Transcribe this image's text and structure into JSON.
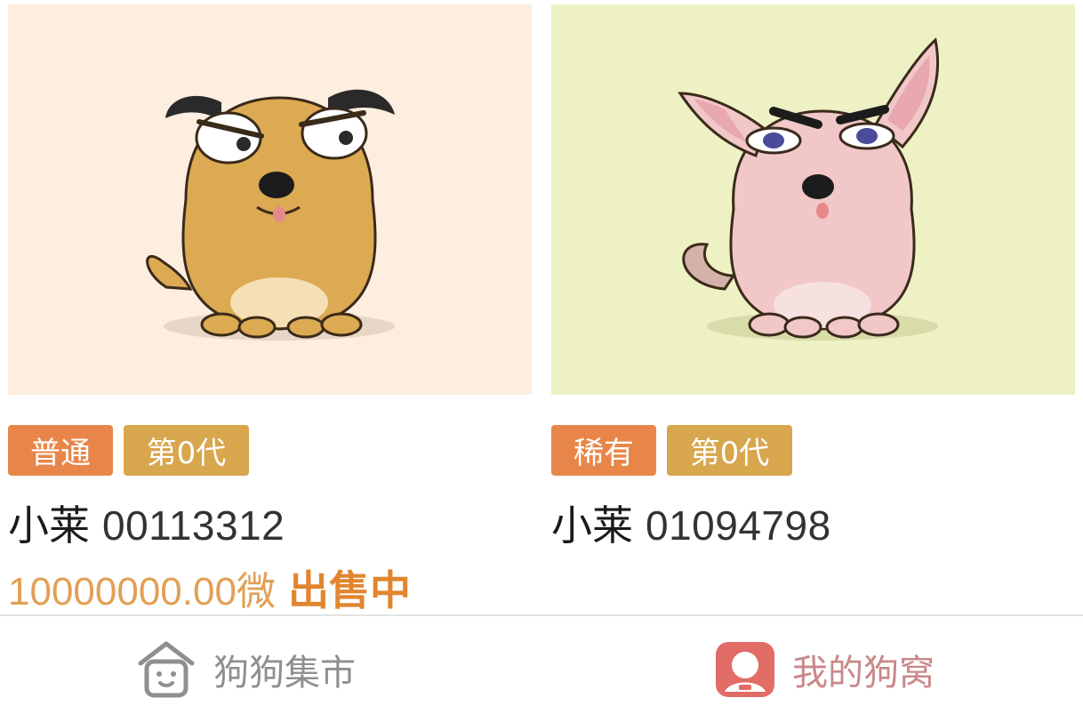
{
  "cards": [
    {
      "rarity": "普通",
      "generation": "第0代",
      "name": "小莱",
      "id": "00113312",
      "price": "10000000.00",
      "price_unit": "微",
      "status": "出售中",
      "bg_color": "#fdeee0",
      "dog_color": "#dcaa52"
    },
    {
      "rarity": "稀有",
      "generation": "第0代",
      "name": "小莱",
      "id": "01094798",
      "bg_color": "#eef1c4",
      "dog_color": "#f1c7c8"
    }
  ],
  "tabbar": {
    "items": [
      {
        "label": "狗狗集市",
        "icon": "dog-house-icon"
      },
      {
        "label": "我的狗窝",
        "icon": "my-kennel-icon"
      }
    ]
  }
}
